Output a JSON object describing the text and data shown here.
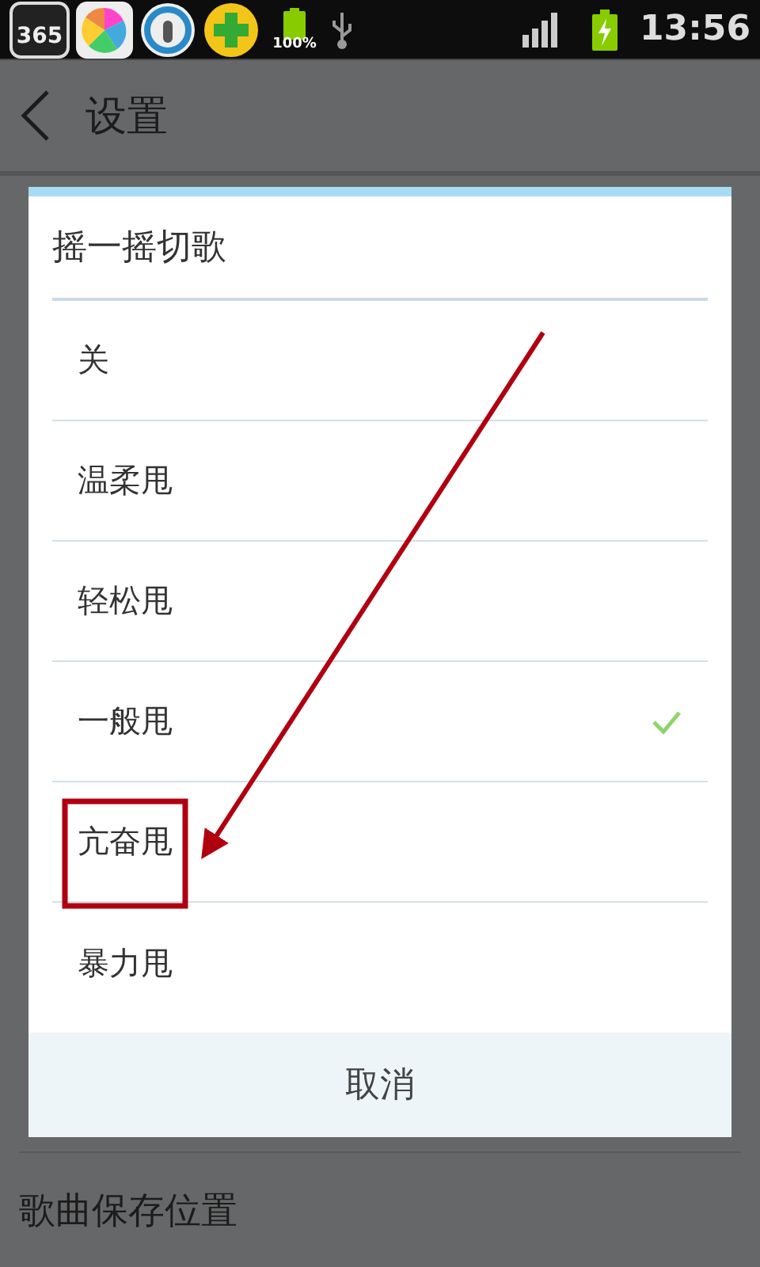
{
  "status_bar": {
    "calendar_badge": "365",
    "battery_percent": "100%",
    "time": "13:56"
  },
  "app_bar": {
    "title": "设置"
  },
  "background_rows": [
    {
      "label": "歌曲保存位置"
    }
  ],
  "dialog": {
    "title": "摇一摇切歌",
    "options": [
      {
        "label": "关",
        "selected": false
      },
      {
        "label": "温柔甩",
        "selected": false
      },
      {
        "label": "轻松甩",
        "selected": false
      },
      {
        "label": "一般甩",
        "selected": true
      },
      {
        "label": "亢奋甩",
        "selected": false
      },
      {
        "label": "暴力甩",
        "selected": false
      }
    ],
    "cancel": "取消"
  }
}
